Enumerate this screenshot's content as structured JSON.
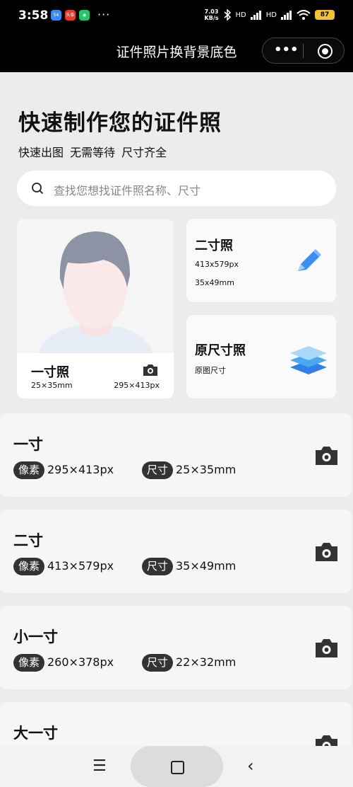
{
  "status": {
    "time": "3:58",
    "more": "···",
    "speed_top": "7.03",
    "speed_bottom": "KB/s",
    "signal1": "HD",
    "signal2": "HD",
    "battery": "87",
    "apps": [
      {
        "label": "54",
        "color": "#3d8af7"
      },
      {
        "label": "头条",
        "color": "#e33b2e"
      },
      {
        "label": "◉",
        "color": "#25c36b"
      }
    ]
  },
  "nav": {
    "title": "证件照片换背景底色",
    "more": "•••"
  },
  "hero": {
    "title": "快速制作您的证件照",
    "subtitle": "快速出图  无需等待  尺寸齐全"
  },
  "search": {
    "placeholder": "查找您想找证件照名称、尺寸"
  },
  "featured": {
    "one_inch": {
      "title": "一寸照",
      "size": "25×35mm",
      "px": "295×413px"
    },
    "two_inch": {
      "title": "二寸照",
      "line1": "413x579px",
      "line2": "35x49mm"
    },
    "original": {
      "title": "原尺寸照",
      "line1": "原图尺寸"
    }
  },
  "list": [
    {
      "title": "一寸",
      "px_label": "像素",
      "px": "295×413px",
      "size_label": "尺寸",
      "size": "25×35mm"
    },
    {
      "title": "二寸",
      "px_label": "像素",
      "px": "413×579px",
      "size_label": "尺寸",
      "size": "35×49mm"
    },
    {
      "title": "小一寸",
      "px_label": "像素",
      "px": "260×378px",
      "size_label": "尺寸",
      "size": "22×32mm"
    },
    {
      "title": "大一寸"
    }
  ],
  "bottom": {
    "menu": "☰",
    "back": "‹"
  },
  "colors": {
    "pencil": "#3a8ff0",
    "layers": "#4aa8f0"
  }
}
